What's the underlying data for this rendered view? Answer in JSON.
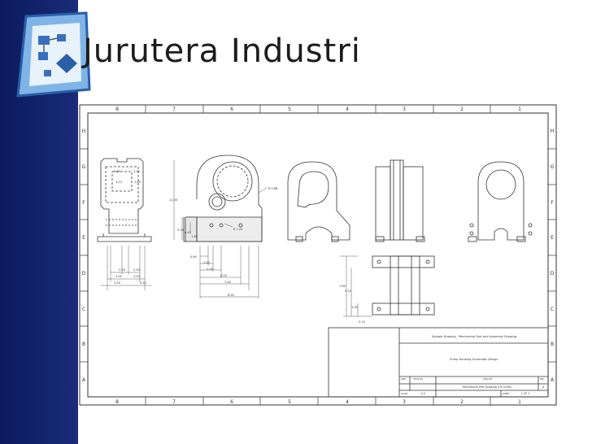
{
  "slide": {
    "title": "Jurutera Industri"
  },
  "border": {
    "columns": [
      "8",
      "7",
      "6",
      "5",
      "4",
      "3",
      "2",
      "1"
    ],
    "rows": [
      "H",
      "G",
      "F",
      "E",
      "D",
      "C",
      "B",
      "A"
    ]
  },
  "dimensions": {
    "top_left": [
      "3.80",
      "2.37",
      "3.13",
      "1.69"
    ],
    "left_height": "11.00",
    "pivot": [
      "3.00",
      "0.43",
      "1.60"
    ],
    "radius_top": "R 0.88",
    "radius_mid": "R 1.20",
    "bottom_offsets": [
      "0.60",
      "1.40",
      "2.00",
      "6.00",
      "7.40",
      "8.50"
    ],
    "front_bottom": [
      "2.50",
      "2.50",
      "3.00",
      "3.00",
      "4.50",
      "4.50"
    ],
    "bottom_view": [
      "7.80",
      "5.10",
      "1.90",
      "0.10"
    ]
  },
  "title_block": {
    "sample_drawing": "Sample Drawing - Mechanical Part and Assembly Drawing",
    "pump_housing": "Pump Housing Schematic Design",
    "size_label": "SIZE",
    "fscm_label": "FSCM NO",
    "dwg_label": "DWG NO",
    "rev_label": "REV",
    "dwg_no": "Mechanical Part Drawing (US Units)",
    "rev": "A",
    "scale_label": "SCALE",
    "scale": "1:4",
    "sheet_label": "SHEET",
    "sheet": "1 OF 1"
  }
}
